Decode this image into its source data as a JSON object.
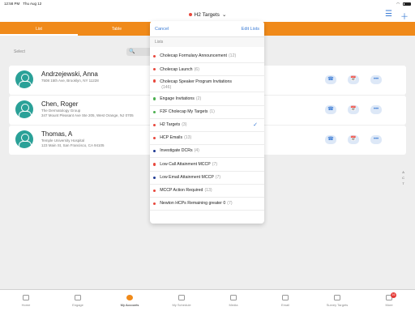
{
  "status": {
    "time": "12:58 PM",
    "date": "Thu Aug 12"
  },
  "nav": {
    "title": "H2 Targets",
    "title_dot_color": "#e8473c",
    "chevron": "⌄",
    "icons": [
      "filter-icon",
      "add-icon"
    ]
  },
  "tabs": [
    {
      "label": "List",
      "active": true
    },
    {
      "label": "Table",
      "active": false
    }
  ],
  "search": {
    "select_label": "Select",
    "search_icon": "🔍"
  },
  "accounts": [
    {
      "name": "Andrzejewski, Anna",
      "line1": "7508 15th Ave, Brooklyn, NY 11228",
      "line2": ""
    },
    {
      "name": "Chen, Roger",
      "line1": "The Dermatology Group",
      "line2": "347 Mount Pleasant Ave Ste 205, West Orange, NJ 0705"
    },
    {
      "name": "Thomas, A",
      "line1": "Temple University Hospital",
      "line2": "123 Main St, San Francisco, CA 94105"
    }
  ],
  "row_snippet": "ycare",
  "action_icons": [
    "📅",
    "☰",
    "•••"
  ],
  "alpha_index": [
    "A",
    "C",
    "T"
  ],
  "dropdown": {
    "cancel": "Cancel",
    "edit": "Edit Lists",
    "section": "Lists",
    "items": [
      {
        "label": "Cholecap Formulary Announcement",
        "count": "(12)",
        "color": "#e8473c"
      },
      {
        "label": "Cholecap Launch",
        "count": "(6)",
        "color": "#e8473c"
      },
      {
        "label": "Cholecap Speaker Program Invitations",
        "count": "(146)",
        "color": "#e8473c",
        "tall": true
      },
      {
        "label": "Engage Invitations",
        "count": "(2)",
        "color": "#4caf50"
      },
      {
        "label": "F2F Cholecap My Targets",
        "count": "(1)",
        "color": "#4caf50"
      },
      {
        "label": "H2 Targets",
        "count": "(3)",
        "color": "#e8473c",
        "selected": true
      },
      {
        "label": "HCP Emails",
        "count": "(13)",
        "color": "#e8473c"
      },
      {
        "label": "Investigate DCRs",
        "count": "(4)",
        "color": "#1f3a93"
      },
      {
        "label": "Low Call Attainment MCCP",
        "count": "(7)",
        "color": "#e8473c"
      },
      {
        "label": "Low Email Attainment MCCP",
        "count": "(7)",
        "color": "#1f3a93"
      },
      {
        "label": "MCCP Action Required",
        "count": "(13)",
        "color": "#e8473c"
      },
      {
        "label": "Newton HCPs Remaining greater 0",
        "count": "(7)",
        "color": "#e8473c"
      }
    ]
  },
  "tabbar": [
    {
      "label": "Home"
    },
    {
      "label": "Engage"
    },
    {
      "label": "My Accounts",
      "active": true
    },
    {
      "label": "My Schedule"
    },
    {
      "label": "Media"
    },
    {
      "label": "Email"
    },
    {
      "label": "Survey Targets"
    },
    {
      "label": "More",
      "badge": "16"
    }
  ]
}
